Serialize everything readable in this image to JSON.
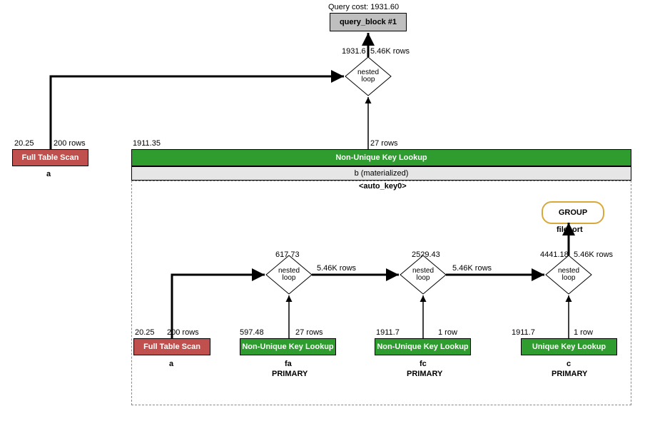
{
  "header": {
    "cost": "Query cost: 1931.60"
  },
  "query_block": {
    "label": "query_block #1"
  },
  "nested_top": {
    "cost": "1931.6",
    "rows": "5.46K rows",
    "label": "nested\nloop"
  },
  "left_scan": {
    "cost": "20.25",
    "rows": "200 rows",
    "label": "Full Table Scan",
    "table": "a"
  },
  "right_lookup": {
    "cost": "1911.35",
    "rows": "27 rows",
    "label": "Non-Unique Key Lookup"
  },
  "mat": {
    "table": "b (materialized)",
    "key": "<auto_key0>"
  },
  "sub": {
    "nl1": {
      "cost": "617.73",
      "label": "nested\nloop"
    },
    "nl2": {
      "cost": "2529.43",
      "label": "nested\nloop"
    },
    "nl3": {
      "label": "nested\nloop"
    },
    "edge12": "5.46K rows",
    "edge23": "5.46K rows",
    "scan": {
      "cost": "20.25",
      "rows": "200 rows",
      "label": "Full Table Scan",
      "table": "a"
    },
    "fa": {
      "cost": "597.48",
      "rows": "27 rows",
      "label": "Non-Unique Key Lookup",
      "table": "fa",
      "key": "PRIMARY"
    },
    "fc": {
      "cost": "1911.7",
      "rows": "1 row",
      "label": "Non-Unique Key Lookup",
      "table": "fc",
      "key": "PRIMARY"
    },
    "c": {
      "cost": "1911.7",
      "rows": "1 row",
      "label": "Unique Key Lookup",
      "table": "c",
      "key": "PRIMARY"
    },
    "group": {
      "label": "GROUP",
      "sort": "filesort",
      "cost": "4441.18",
      "rows": "5.46K rows"
    }
  }
}
